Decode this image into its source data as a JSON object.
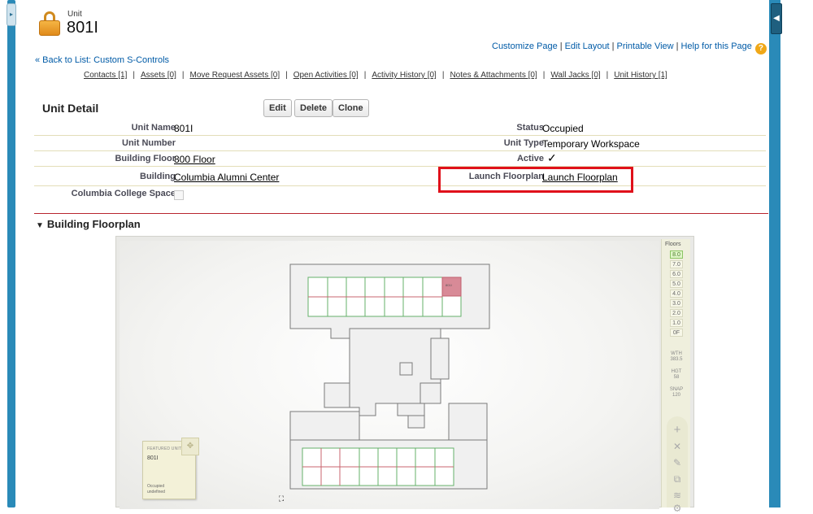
{
  "header": {
    "object_type": "Unit",
    "record_name": "801I",
    "icon": "lock-icon"
  },
  "top_links": [
    "Customize Page",
    "Edit Layout",
    "Printable View",
    "Help for this Page"
  ],
  "help_icon_glyph": "?",
  "back_link": "« Back to List: Custom S-Controls",
  "related_links": [
    "Contacts [1]",
    "Assets [0]",
    "Move Request Assets [0]",
    "Open Activities [0]",
    "Activity History [0]",
    "Notes & Attachments [0]",
    "Wall Jacks [0]",
    "Unit History [1]"
  ],
  "detail": {
    "title": "Unit Detail",
    "buttons": {
      "edit": "Edit",
      "delete": "Delete",
      "clone": "Clone"
    },
    "left_fields": [
      {
        "label": "Unit Name",
        "value": "801I"
      },
      {
        "label": "Unit Number",
        "value": ""
      },
      {
        "label": "Building Floor",
        "value": "800 Floor"
      },
      {
        "label": "Building",
        "value": "Columbia Alumni Center"
      },
      {
        "label": "Columbia College Space",
        "value": ""
      }
    ],
    "right_fields": [
      {
        "label": "Status",
        "value": "Occupied"
      },
      {
        "label": "Unit Type",
        "value": "Temporary Workspace"
      },
      {
        "label": "Active",
        "value": "✓"
      },
      {
        "label": "Launch Floorplan",
        "value": "Launch Floorplan"
      }
    ]
  },
  "floorplan": {
    "section_title": "Building Floorplan",
    "collapse_glyph": "▼",
    "highlighted_unit": "801I",
    "floors_title": "Floors",
    "floors": [
      "8.0",
      "7.0",
      "6.0",
      "5.0",
      "4.0",
      "3.0",
      "2.0",
      "1.0",
      "0F"
    ],
    "active_floor": "8.0",
    "info": [
      {
        "label": "WTH",
        "value": "383.5"
      },
      {
        "label": "HGT",
        "value": "58"
      },
      {
        "label": "SNAP",
        "value": "120"
      }
    ],
    "tools": [
      "+",
      "✕",
      "✎",
      "⧉",
      "≋",
      "⚙"
    ],
    "featured_card": {
      "title": "FEATURED UNIT",
      "name": "801I",
      "status_line1": "Occupied",
      "status_line2": "undefined"
    },
    "move_glyph": "✥",
    "fullscreen_glyph": "⛶"
  },
  "side_handles": {
    "left": "▸",
    "right": "◀"
  },
  "colors": {
    "link": "#015ba7",
    "highlight_border": "#e0101a",
    "section_line": "#b8262e",
    "side_bar": "#2a8ab8",
    "occupied_unit": "#d88a97",
    "unit_outline_green": "#64b06a",
    "unit_outline_red": "#c9646f"
  }
}
